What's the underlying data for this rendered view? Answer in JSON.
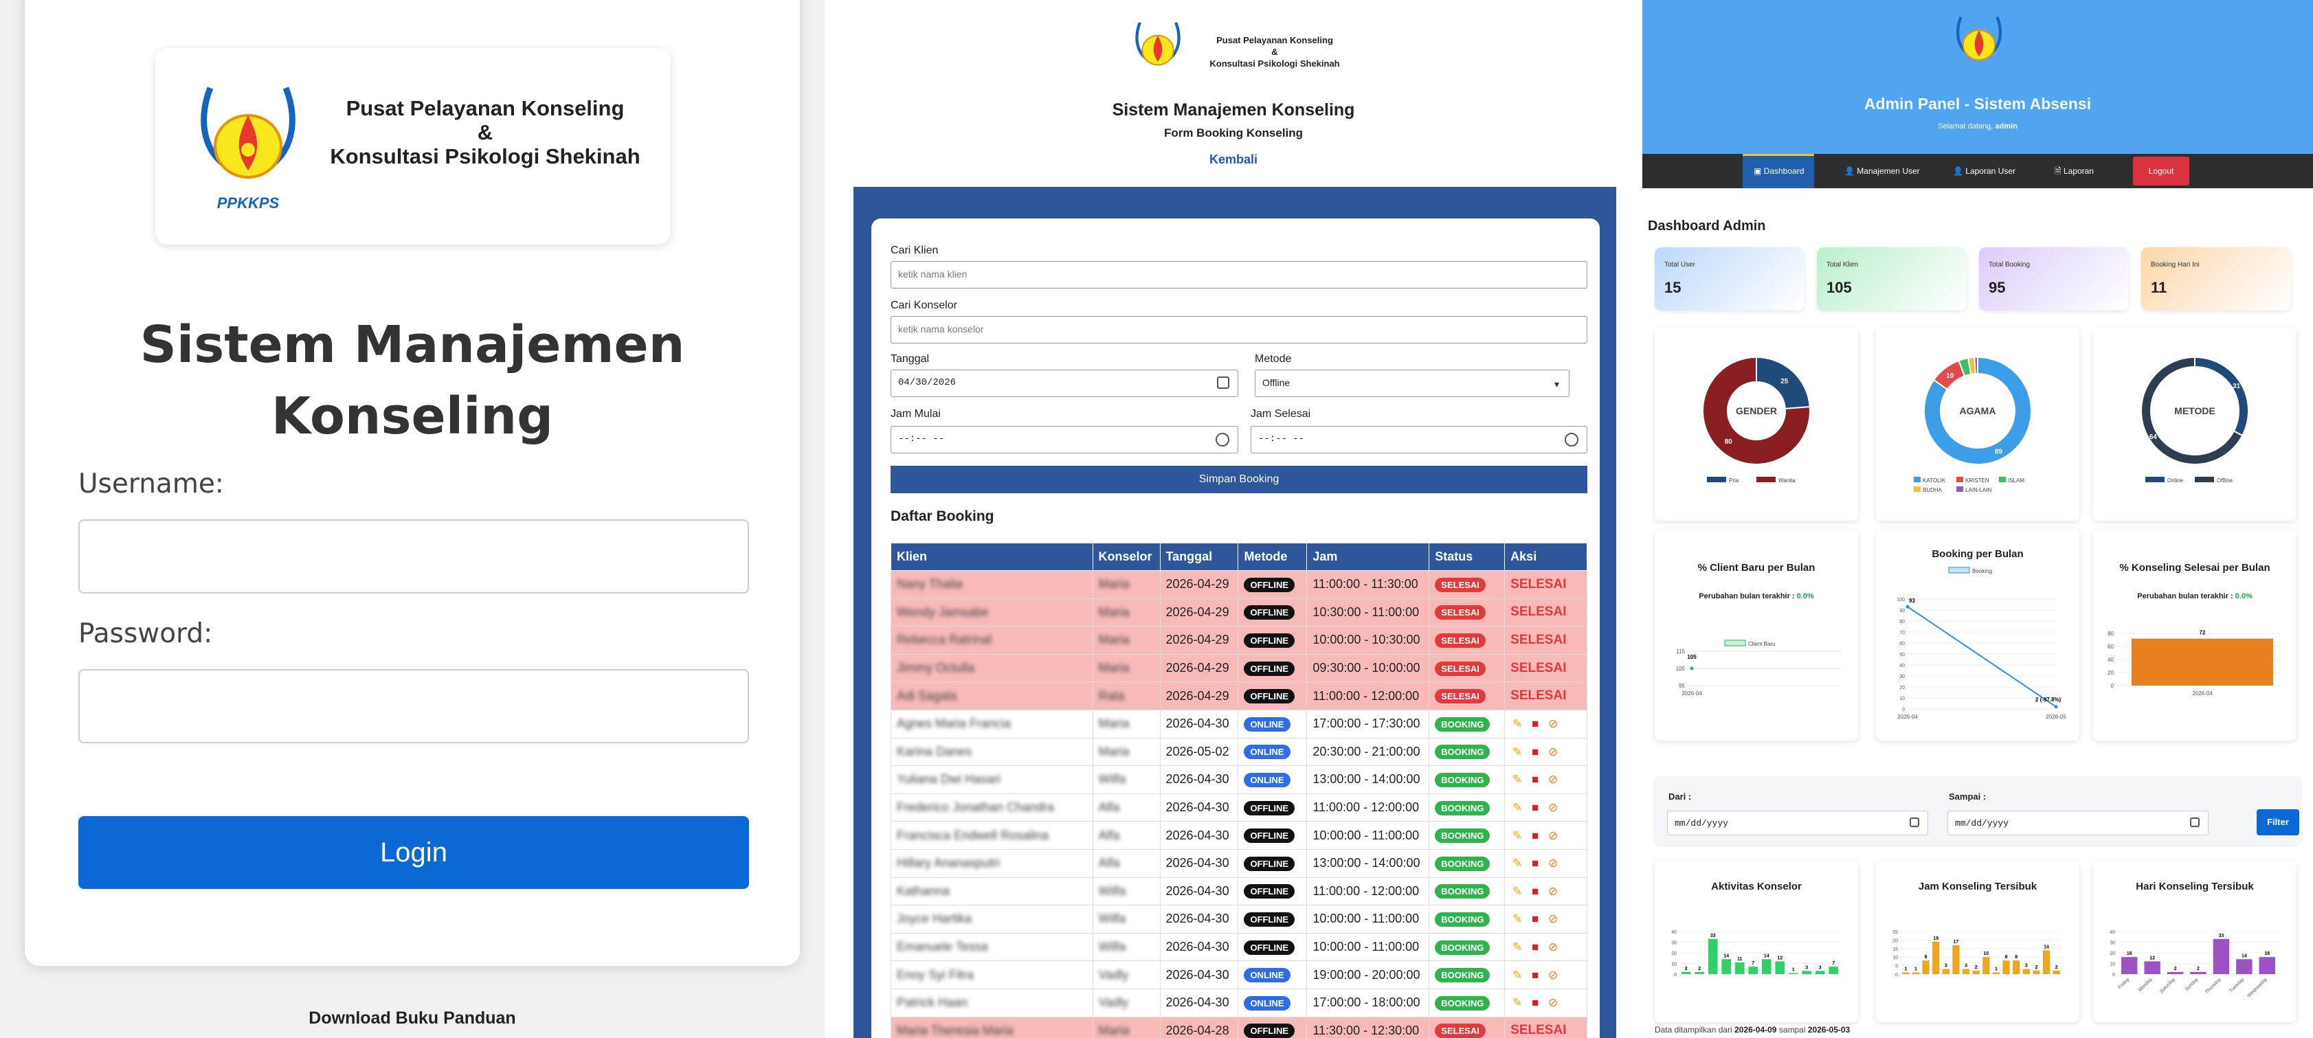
{
  "login": {
    "org_line1": "Pusat Pelayanan Konseling",
    "org_line2": "&",
    "org_line3": "Konsultasi Psikologi Shekinah",
    "logo_text": "PPKKPS",
    "title": "Sistem Manajemen Konseling",
    "username_label": "Username:",
    "password_label": "Password:",
    "login_button": "Login",
    "download_link": "Download Buku Panduan"
  },
  "booking": {
    "title": "Sistem Manajemen Konseling",
    "subtitle": "Form Booking Konseling",
    "back_link": "Kembali",
    "fields": {
      "cari_klien_label": "Cari Klien",
      "cari_klien_placeholder": "ketik nama klien",
      "cari_konselor_label": "Cari Konselor",
      "cari_konselor_placeholder": "ketik nama konselor",
      "tanggal_label": "Tanggal",
      "tanggal_value": "04/30/2026",
      "metode_label": "Metode",
      "metode_value": "Offline",
      "jam_mulai_label": "Jam Mulai",
      "jam_selesai_label": "Jam Selesai",
      "time_placeholder": "--:-- --"
    },
    "save_button": "Simpan Booking",
    "list_title": "Daftar Booking",
    "columns": [
      "Klien",
      "Konselor",
      "Tanggal",
      "Metode",
      "Jam",
      "Status",
      "Aksi"
    ],
    "rows": [
      {
        "klien": "Nany Thalia",
        "konselor": "Maria",
        "tanggal": "2026-04-29",
        "metode": "OFFLINE",
        "jam": "11:00:00 - 11:30:00",
        "status": "SELESAI",
        "aksi": "SELESAI"
      },
      {
        "klien": "Wendy Jamsabe",
        "konselor": "Maria",
        "tanggal": "2026-04-29",
        "metode": "OFFLINE",
        "jam": "10:30:00 - 11:00:00",
        "status": "SELESAI",
        "aksi": "SELESAI"
      },
      {
        "klien": "Rebecca Ratrinal",
        "konselor": "Maria",
        "tanggal": "2026-04-29",
        "metode": "OFFLINE",
        "jam": "10:00:00 - 10:30:00",
        "status": "SELESAI",
        "aksi": "SELESAI"
      },
      {
        "klien": "Jimmy Octulla",
        "konselor": "Maria",
        "tanggal": "2026-04-29",
        "metode": "OFFLINE",
        "jam": "09:30:00 - 10:00:00",
        "status": "SELESAI",
        "aksi": "SELESAI"
      },
      {
        "klien": "Adi Sagala",
        "konselor": "Rata",
        "tanggal": "2026-04-29",
        "metode": "OFFLINE",
        "jam": "11:00:00 - 12:00:00",
        "status": "SELESAI",
        "aksi": "SELESAI"
      },
      {
        "klien": "Agnes Maria Francia",
        "konselor": "Maria",
        "tanggal": "2026-04-30",
        "metode": "ONLINE",
        "jam": "17:00:00 - 17:30:00",
        "status": "BOOKING",
        "aksi": ""
      },
      {
        "klien": "Karina Danes",
        "konselor": "Maria",
        "tanggal": "2026-05-02",
        "metode": "ONLINE",
        "jam": "20:30:00 - 21:00:00",
        "status": "BOOKING",
        "aksi": ""
      },
      {
        "klien": "Yuliana Dwi Hasari",
        "konselor": "Wilfa",
        "tanggal": "2026-04-30",
        "metode": "ONLINE",
        "jam": "13:00:00 - 14:00:00",
        "status": "BOOKING",
        "aksi": ""
      },
      {
        "klien": "Frederico Jonathan Chandra",
        "konselor": "Alfa",
        "tanggal": "2026-04-30",
        "metode": "OFFLINE",
        "jam": "11:00:00 - 12:00:00",
        "status": "BOOKING",
        "aksi": ""
      },
      {
        "klien": "Francisca Endwell Rosalina",
        "konselor": "Alfa",
        "tanggal": "2026-04-30",
        "metode": "OFFLINE",
        "jam": "10:00:00 - 11:00:00",
        "status": "BOOKING",
        "aksi": ""
      },
      {
        "klien": "Hillary Ananasputri",
        "konselor": "Alfa",
        "tanggal": "2026-04-30",
        "metode": "OFFLINE",
        "jam": "13:00:00 - 14:00:00",
        "status": "BOOKING",
        "aksi": ""
      },
      {
        "klien": "Kathanna",
        "konselor": "Wilfa",
        "tanggal": "2026-04-30",
        "metode": "OFFLINE",
        "jam": "11:00:00 - 12:00:00",
        "status": "BOOKING",
        "aksi": ""
      },
      {
        "klien": "Joyce Hartika",
        "konselor": "Wilfa",
        "tanggal": "2026-04-30",
        "metode": "OFFLINE",
        "jam": "10:00:00 - 11:00:00",
        "status": "BOOKING",
        "aksi": ""
      },
      {
        "klien": "Emanuele Tessa",
        "konselor": "Wilfa",
        "tanggal": "2026-04-30",
        "metode": "OFFLINE",
        "jam": "10:00:00 - 11:00:00",
        "status": "BOOKING",
        "aksi": ""
      },
      {
        "klien": "Enoy Syi Fitra",
        "konselor": "Vadly",
        "tanggal": "2026-04-30",
        "metode": "ONLINE",
        "jam": "19:00:00 - 20:00:00",
        "status": "BOOKING",
        "aksi": ""
      },
      {
        "klien": "Patrick Haan",
        "konselor": "Vadly",
        "tanggal": "2026-04-30",
        "metode": "ONLINE",
        "jam": "17:00:00 - 18:00:00",
        "status": "BOOKING",
        "aksi": ""
      },
      {
        "klien": "Maria Theresia Maria",
        "konselor": "Maria",
        "tanggal": "2026-04-28",
        "metode": "OFFLINE",
        "jam": "11:30:00 - 12:30:00",
        "status": "SELESAI",
        "aksi": "SELESAI"
      }
    ]
  },
  "admin": {
    "title": "Admin Panel - Sistem Absensi",
    "welcome": "Selamat datang,",
    "user": "admin",
    "nav": [
      "Dashboard",
      "Manajemen User",
      "Laporan User",
      "Laporan",
      "Logout"
    ],
    "heading": "Dashboard Admin",
    "stats": [
      {
        "label": "Total User",
        "value": "15",
        "color": "#bcd8fb"
      },
      {
        "label": "Total Klien",
        "value": "105",
        "color": "#b9efca"
      },
      {
        "label": "Total Booking",
        "value": "95",
        "color": "#dccbf9"
      },
      {
        "label": "Booking Hari Ini",
        "value": "11",
        "color": "#fbd6a8"
      }
    ],
    "donut_gender": {
      "label": "GENDER",
      "values": [
        25,
        80
      ],
      "legend": [
        "Pria",
        "Wanita"
      ],
      "colors": [
        "#1f4a7a",
        "#8a1f23"
      ]
    },
    "donut_agama": {
      "label": "AGAMA",
      "values": [
        89,
        10,
        3,
        2,
        1
      ],
      "legend": [
        "KATOLIK",
        "KRISTEN",
        "ISLAM",
        "BUDHA",
        "LAIN-LAIN"
      ],
      "colors": [
        "#3b9ee6",
        "#e34a4a",
        "#3ac06a",
        "#f2c232",
        "#9b59b6"
      ],
      "labels": [
        "89",
        "10"
      ]
    },
    "donut_metode": {
      "label": "METODE",
      "values": [
        31,
        64
      ],
      "legend": [
        "Online",
        "Offline"
      ],
      "colors": [
        "#1f4a7a",
        "#2c3e50"
      ]
    },
    "client_baru": {
      "title": "% Client Baru per Bulan",
      "sub": "Perubahan bulan terakhir :",
      "change": "0.0%",
      "legend": "Client Baru",
      "point_label": "105",
      "yticks": [
        "115",
        "105",
        "95"
      ],
      "x": [
        "2026-04"
      ]
    },
    "booking_bulan": {
      "title": "Booking per Bulan",
      "legend": "Booking",
      "start_label": "93",
      "end_label": "2 (-97.8%)",
      "yticks": [
        "100",
        "90",
        "80",
        "70",
        "60",
        "50",
        "40",
        "30",
        "20",
        "10",
        "0"
      ],
      "x": [
        "2026-04",
        "2026-05"
      ]
    },
    "konseling_selesai": {
      "title": "% Konseling Selesai per Bulan",
      "sub": "Perubahan bulan terakhir :",
      "change": "0.0%",
      "bar_label": "72",
      "yticks": [
        "80",
        "60",
        "40",
        "20",
        "0"
      ],
      "x": [
        "2026-04"
      ]
    },
    "filter": {
      "dari_label": "Dari :",
      "sampai_label": "Sampai :",
      "placeholder": "mm/dd/yyyy",
      "button": "Filter"
    },
    "aktivitas": {
      "title": "Aktivitas Konselor",
      "values": [
        2,
        2,
        33,
        14,
        11,
        7,
        14,
        12,
        1,
        3,
        3,
        7
      ],
      "yticks": [
        "40",
        "30",
        "20",
        "10",
        "0"
      ]
    },
    "jam": {
      "title": "Jam Konseling Tersibuk",
      "values": [
        1,
        1,
        8,
        19,
        3,
        17,
        3,
        2,
        10,
        1,
        8,
        8,
        3,
        2,
        14,
        2
      ],
      "labels": [
        "1",
        "1",
        "8",
        "19",
        "3",
        "17",
        "3",
        "2",
        "10",
        "1",
        "8",
        "8",
        "3",
        "2",
        "14",
        "2"
      ],
      "yticks": [
        "25",
        "20",
        "15",
        "10",
        "5",
        "0"
      ]
    },
    "hari": {
      "title": "Hari Konseling Tersibuk",
      "categories": [
        "Friday",
        "Monday",
        "Saturday",
        "Sunday",
        "Thursday",
        "Tuesday",
        "Wednesday"
      ],
      "values": [
        16,
        12,
        2,
        2,
        33,
        14,
        16
      ],
      "yticks": [
        "40",
        "30",
        "20",
        "10",
        "0"
      ]
    },
    "footnote_prefix": "Data ditampilkan dari",
    "footnote_from": "2026-04-09",
    "footnote_mid": "sampai",
    "footnote_to": "2026-05-03"
  }
}
